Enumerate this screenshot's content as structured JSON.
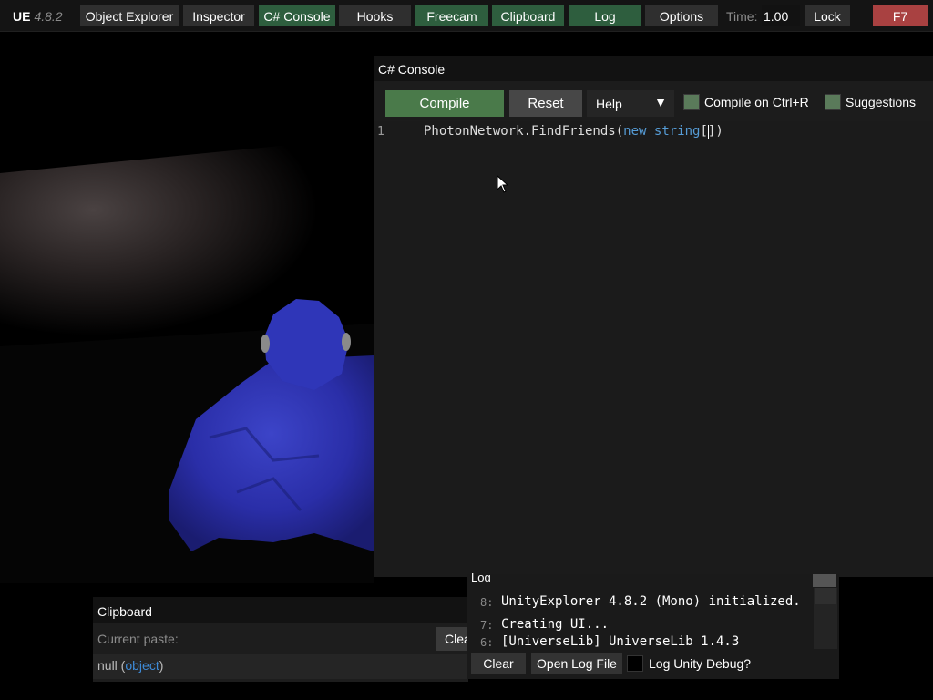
{
  "navbar": {
    "brand": "UE",
    "version": "4.8.2",
    "buttons": [
      {
        "label": "Object Explorer",
        "active": false
      },
      {
        "label": "Inspector",
        "active": false
      },
      {
        "label": "C# Console",
        "active": true
      },
      {
        "label": "Hooks",
        "active": false
      },
      {
        "label": "Freecam",
        "active": true
      },
      {
        "label": "Clipboard",
        "active": true
      },
      {
        "label": "Log",
        "active": true
      },
      {
        "label": "Options",
        "active": false
      }
    ],
    "time_label": "Time:",
    "time_value": "1.00",
    "lock_label": "Lock",
    "toggle_key": "F7"
  },
  "console": {
    "title": "C# Console",
    "compile_label": "Compile",
    "reset_label": "Reset",
    "help_label": "Help",
    "compile_on_ctrl_r_label": "Compile on Ctrl+R",
    "suggestions_label": "Suggestions",
    "line_number": "1",
    "code": {
      "prefix": "PhotonNetwork.FindFriends(",
      "kw_new": "new",
      "kw_string": "string",
      "brackets": "[",
      "after_caret": "]",
      "close": ")"
    }
  },
  "clipboard": {
    "title": "Clipboard",
    "current_paste_label": "Current paste:",
    "clear_label": "Clear",
    "value": "null",
    "type": "object"
  },
  "log": {
    "title": "Log",
    "entries": [
      {
        "num": "8:",
        "msg": "UnityExplorer 4.8.2 (Mono) initialized."
      },
      {
        "num": "7:",
        "msg": "Creating UI..."
      },
      {
        "num": "6:",
        "msg": "[UniverseLib] UniverseLib 1.4.3"
      }
    ],
    "clear_label": "Clear",
    "open_log_file_label": "Open Log File",
    "log_unity_debug_label": "Log Unity Debug?"
  },
  "colors": {
    "active_tab": "#2e5e3e",
    "toggle_key": "#a94141",
    "compile": "#4a7a4a",
    "keyword": "#569cd6",
    "type_link": "#3e8bd8"
  }
}
